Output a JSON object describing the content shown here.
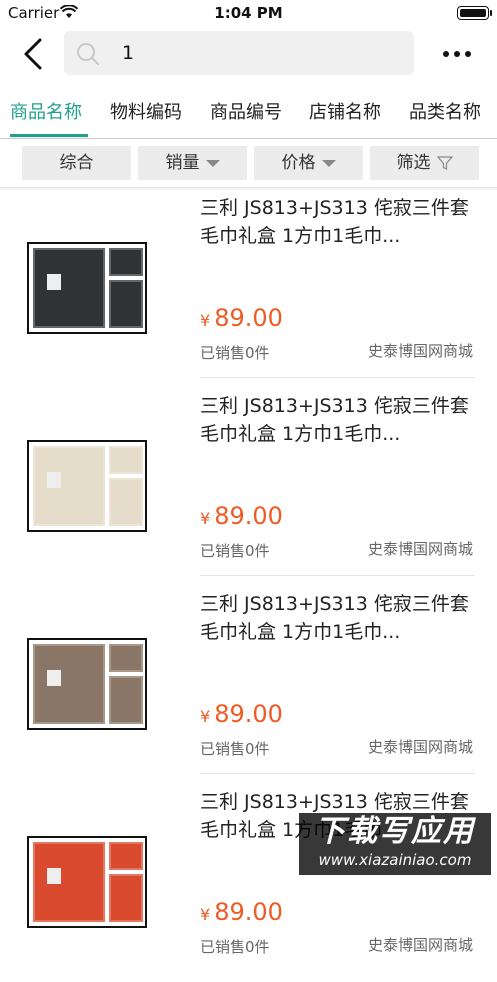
{
  "status": {
    "carrier": "Carrier",
    "time": "1:04 PM"
  },
  "search": {
    "value": "1"
  },
  "tabs": [
    "商品名称",
    "物料编码",
    "商品编号",
    "店铺名称",
    "品类名称"
  ],
  "filters": {
    "comprehensive": "综合",
    "sales": "销量",
    "price": "价格",
    "filter": "筛选"
  },
  "products": [
    {
      "title": "三利 JS813+JS313 侘寂三件套毛巾礼盒 1方巾1毛巾...",
      "currency": "¥",
      "price": "89.00",
      "sold": "已销售0件",
      "shop": "史泰博国网商城",
      "color": "#2f3336"
    },
    {
      "title": "三利 JS813+JS313 侘寂三件套毛巾礼盒 1方巾1毛巾...",
      "currency": "¥",
      "price": "89.00",
      "sold": "已销售0件",
      "shop": "史泰博国网商城",
      "color": "#e6dcca"
    },
    {
      "title": "三利 JS813+JS313 侘寂三件套毛巾礼盒 1方巾1毛巾...",
      "currency": "¥",
      "price": "89.00",
      "sold": "已销售0件",
      "shop": "史泰博国网商城",
      "color": "#8a7666"
    },
    {
      "title": "三利 JS813+JS313 侘寂三件套毛巾礼盒 1方巾1毛巾...",
      "currency": "¥",
      "price": "89.00",
      "sold": "已销售0件",
      "shop": "史泰博国网商城",
      "color": "#d94a2e"
    }
  ],
  "watermark": {
    "line1": "下载写应用",
    "line2": "www.xiazainiao.com"
  }
}
